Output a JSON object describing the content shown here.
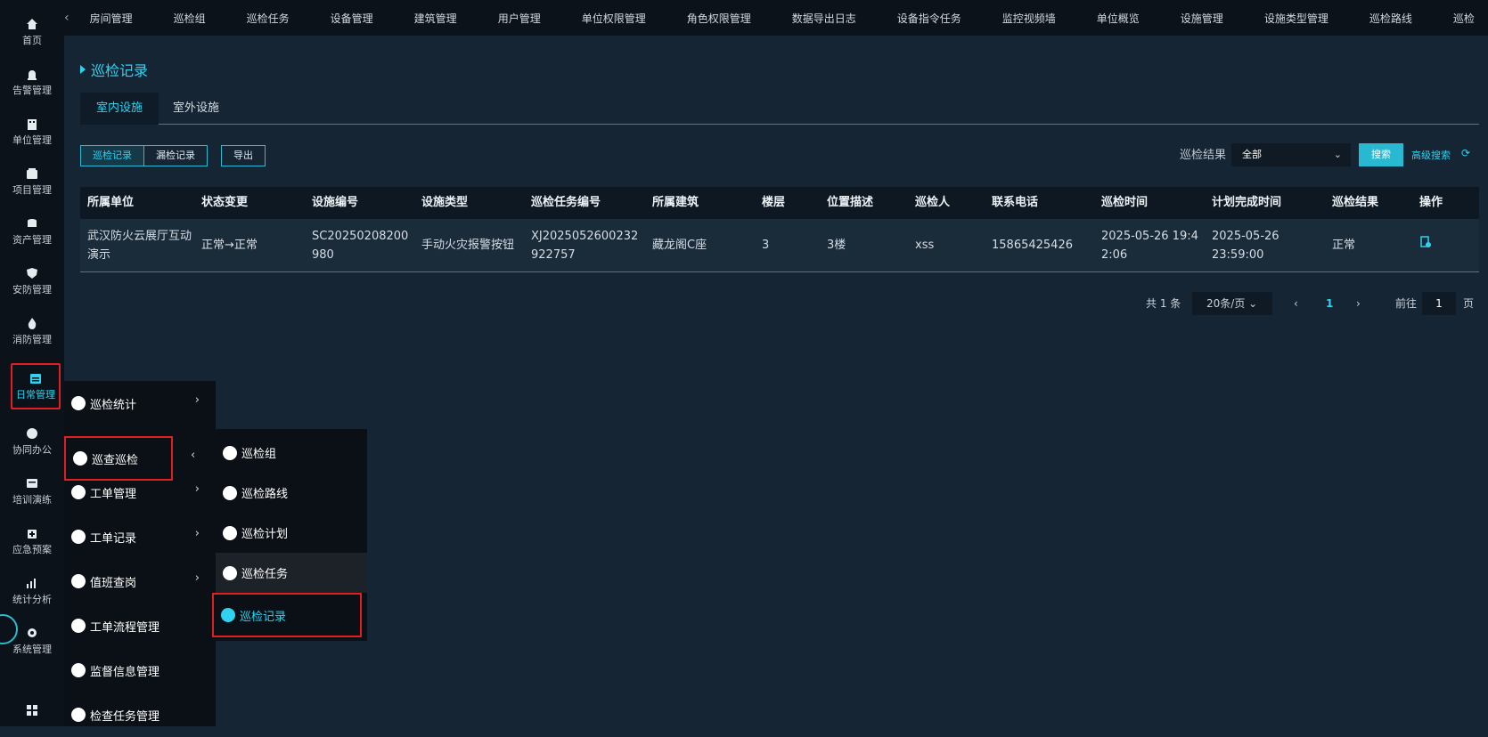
{
  "sidebar": {
    "items": [
      {
        "label": "首页",
        "icon": "home-icon"
      },
      {
        "label": "告警管理",
        "icon": "alarm-icon"
      },
      {
        "label": "单位管理",
        "icon": "building-icon"
      },
      {
        "label": "项目管理",
        "icon": "project-icon"
      },
      {
        "label": "资产管理",
        "icon": "asset-icon"
      },
      {
        "label": "安防管理",
        "icon": "shield-icon"
      },
      {
        "label": "消防管理",
        "icon": "fire-icon"
      },
      {
        "label": "日常管理",
        "icon": "calendar-icon"
      },
      {
        "label": "协同办公",
        "icon": "cooperate-icon"
      },
      {
        "label": "培训演练",
        "icon": "training-icon"
      },
      {
        "label": "应急预案",
        "icon": "emergency-icon"
      },
      {
        "label": "统计分析",
        "icon": "statistics-icon"
      },
      {
        "label": "系统管理",
        "icon": "system-icon"
      }
    ]
  },
  "topnav": {
    "items": [
      "房间管理",
      "巡检组",
      "巡检任务",
      "设备管理",
      "建筑管理",
      "用户管理",
      "单位权限管理",
      "角色权限管理",
      "数据导出日志",
      "设备指令任务",
      "监控视频墙",
      "单位概览",
      "设施管理",
      "设施类型管理",
      "巡检路线",
      "巡检"
    ]
  },
  "page": {
    "title": "巡检记录",
    "tabs": [
      "室内设施",
      "室外设施"
    ],
    "record_btn": "巡检记录",
    "missed_btn": "漏检记录",
    "export_btn": "导出",
    "filter_label": "巡检结果",
    "filter_value": "全部",
    "search_btn": "搜索",
    "adv_search": "高级搜索"
  },
  "table": {
    "headers": [
      "所属单位",
      "状态变更",
      "设施编号",
      "设施类型",
      "巡检任务编号",
      "所属建筑",
      "楼层",
      "位置描述",
      "巡检人",
      "联系电话",
      "巡检时间",
      "计划完成时间",
      "巡检结果",
      "操作"
    ],
    "rows": [
      [
        "武汉防火云展厅互动演示",
        "正常→正常",
        "SC20250208200980",
        "手动火灾报警按钮",
        "XJ2025052600232922757",
        "藏龙阁C座",
        "3",
        "3楼",
        "xss",
        "15865425426",
        "2025-05-26 19:42:06",
        "2025-05-26 23:59:00",
        "正常",
        ""
      ]
    ]
  },
  "pager": {
    "total": "共 1 条",
    "page_size": "20条/页",
    "current": "1",
    "goto_prefix": "前往",
    "goto_value": "1",
    "goto_suffix": "页"
  },
  "menu": {
    "level1": [
      "巡检统计",
      "巡查巡检",
      "工单管理",
      "工单记录",
      "值班查岗",
      "工单流程管理",
      "监督信息管理",
      "检查任务管理"
    ],
    "level2": [
      "巡检组",
      "巡检路线",
      "巡检计划",
      "巡检任务",
      "巡检记录"
    ]
  },
  "colors": {
    "accent": "#2fd3f0",
    "highlight": "#e02020",
    "bg": "#152534"
  }
}
